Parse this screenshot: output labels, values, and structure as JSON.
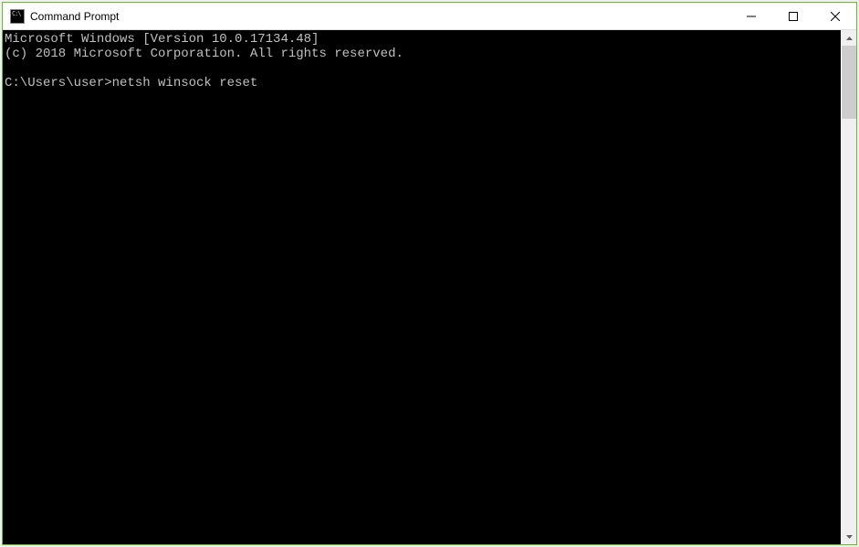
{
  "window": {
    "title": "Command Prompt",
    "icon_text": "C:\\"
  },
  "controls": {
    "minimize": "minimize",
    "maximize": "maximize",
    "close": "close"
  },
  "console": {
    "lines": [
      "Microsoft Windows [Version 10.0.17134.48]",
      "(c) 2018 Microsoft Corporation. All rights reserved.",
      "",
      "C:\\Users\\user>netsh winsock reset"
    ],
    "prompt": "C:\\Users\\user>",
    "command": "netsh winsock reset"
  }
}
